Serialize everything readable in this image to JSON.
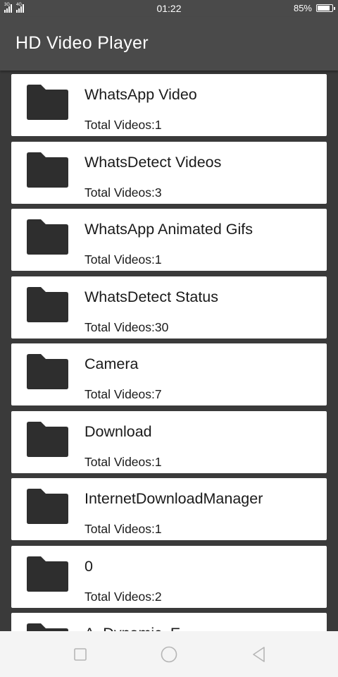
{
  "status_bar": {
    "time": "01:22",
    "battery_percent": "85%",
    "battery_level": 0.85,
    "signal_tags": [
      "3G",
      "4G"
    ]
  },
  "app": {
    "title": "HD Video Player"
  },
  "folders": [
    {
      "name": "WhatsApp Video",
      "count": "Total Videos:1"
    },
    {
      "name": "WhatsDetect Videos",
      "count": "Total Videos:3"
    },
    {
      "name": "WhatsApp Animated Gifs",
      "count": "Total Videos:1"
    },
    {
      "name": "WhatsDetect Status",
      "count": "Total Videos:30"
    },
    {
      "name": "Camera",
      "count": "Total Videos:7"
    },
    {
      "name": "Download",
      "count": "Total Videos:1"
    },
    {
      "name": "InternetDownloadManager",
      "count": "Total Videos:1"
    },
    {
      "name": "0",
      "count": "Total Videos:2"
    },
    {
      "name": "A_Dynamic_E",
      "count": ""
    }
  ],
  "colors": {
    "background": "#3a3a3a",
    "app_bar": "#4a4a4a",
    "card": "#ffffff",
    "folder_icon": "#2e2e2e",
    "nav_bar": "#f4f4f4",
    "nav_icon": "#b5b5b5"
  },
  "icons": {
    "folder": "folder-icon",
    "nav_recent": "square-icon",
    "nav_home": "circle-icon",
    "nav_back": "triangle-back-icon"
  }
}
